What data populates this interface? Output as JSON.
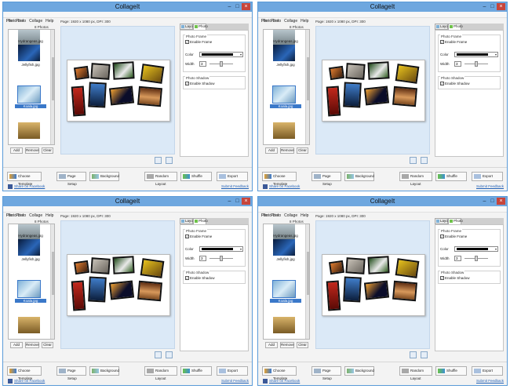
{
  "app": {
    "title": "CollageIt",
    "menu": [
      "File",
      "Photo",
      "Collage",
      "Help"
    ]
  },
  "photo_list": {
    "label": "Photo List",
    "count": "8 Photos",
    "files": [
      "Hydrangeas.jpg",
      "Jellyfish.jpg",
      "Koala.jpg"
    ],
    "buttons": {
      "add": "Add",
      "remove": "Remove",
      "clear": "Clear"
    }
  },
  "canvas": {
    "page_info": "Page: 1920 x 1080 px, DPI: 300"
  },
  "panel": {
    "tabs": [
      "Layout",
      "Photo"
    ],
    "photo_frame": {
      "title": "Photo Frame",
      "enable_frame": "Enable Frame",
      "color_label": "Color",
      "color_value": "#000000",
      "width_label": "Width",
      "width_value": "3"
    },
    "photo_shadow": {
      "title": "Photo Shadow",
      "enable_shadow": "Enable Shadow"
    }
  },
  "bottom": {
    "choose_template": "Choose Template",
    "page_setup": "Page Setup",
    "background": "Background",
    "random_layout": "Random Layout",
    "shuffle": "Shuffle",
    "export": "Export",
    "share": "Share on Facebook",
    "feedback": "Submit Feedback"
  },
  "colors": {
    "titlebar": "#6ea7df",
    "close": "#c7453b",
    "canvas": "#dbe9f7"
  }
}
